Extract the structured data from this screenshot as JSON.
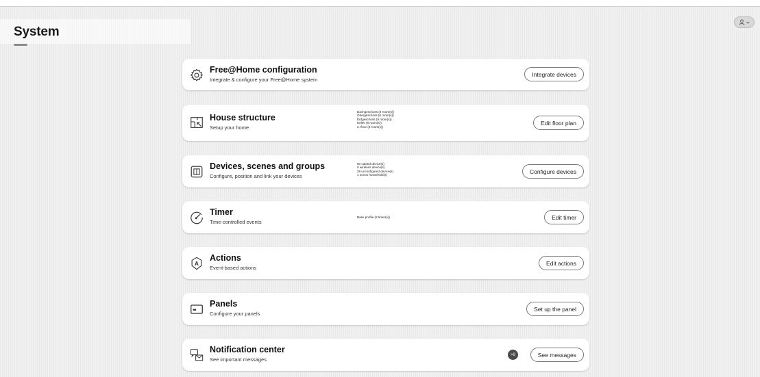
{
  "page": {
    "title": "System"
  },
  "user_menu": {
    "icon": "user-icon",
    "chevron": "chevron-down-icon"
  },
  "colors": {
    "card_bg": "#ffffff",
    "page_bg": "#f1f1f1",
    "badge": "#4a4a4a",
    "button_border": "#777777"
  },
  "cards": [
    {
      "title": "Free@Home configuration",
      "subtitle": "Integrate & configure your Free@Home system",
      "icon": "gear-icon",
      "info": [],
      "button": "Integrate devices"
    },
    {
      "title": "House structure",
      "subtitle": "Setup your home",
      "icon": "floor-plan-icon",
      "info": [
        "Dachgeschoss (4 room(s))",
        "Obergeschoss (6 room(s))",
        "Erdgeschoss (9 room(s))",
        "Keller (8 room(s))",
        "2. floor (4 room(s))"
      ],
      "button": "Edit floor plan"
    },
    {
      "title": "Devices, scenes and groups",
      "subtitle": "Configure, position and link your devices",
      "icon": "device-icon",
      "info": [
        "50 cabled device(s)",
        "0 wireless device(s)",
        "28 unconfigured device(s)",
        "1 sonos household(s)"
      ],
      "button": "Configure devices"
    },
    {
      "title": "Timer",
      "subtitle": "Time-controlled events",
      "icon": "timer-icon",
      "info": [
        "Base profile (6 timer(s))"
      ],
      "button": "Edit timer"
    },
    {
      "title": "Actions",
      "subtitle": "Event-based actions",
      "icon": "actions-icon",
      "info": [],
      "button": "Edit actions"
    },
    {
      "title": "Panels",
      "subtitle": "Configure your panels",
      "icon": "panel-icon",
      "info": [],
      "button": "Set up the panel"
    },
    {
      "title": "Notification center",
      "subtitle": "See important messages",
      "icon": "notification-icon",
      "info": [],
      "badge": ">9",
      "button": "See messages"
    }
  ]
}
